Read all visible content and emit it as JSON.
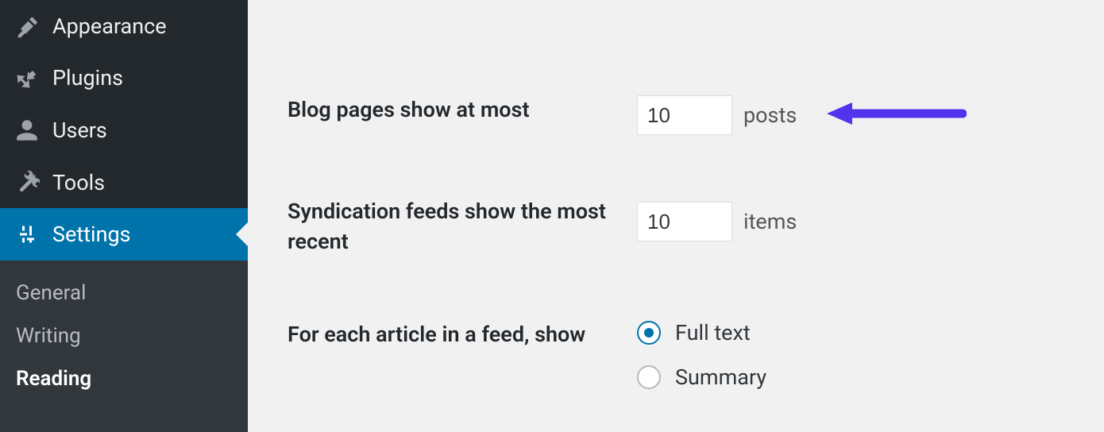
{
  "sidebar": {
    "items": [
      {
        "label": "Appearance"
      },
      {
        "label": "Plugins"
      },
      {
        "label": "Users"
      },
      {
        "label": "Tools"
      },
      {
        "label": "Settings"
      }
    ],
    "submenu": [
      {
        "label": "General"
      },
      {
        "label": "Writing"
      },
      {
        "label": "Reading"
      }
    ]
  },
  "settings": {
    "blog_pages": {
      "label": "Blog pages show at most",
      "value": "10",
      "unit": "posts"
    },
    "syndication": {
      "label": "Syndication feeds show the most recent",
      "value": "10",
      "unit": "items"
    },
    "feed_article": {
      "label": "For each article in a feed, show",
      "options": [
        {
          "label": "Full text",
          "selected": true
        },
        {
          "label": "Summary",
          "selected": false
        }
      ]
    }
  },
  "colors": {
    "sidebar_bg": "#23282d",
    "sidebar_active": "#0073aa",
    "submenu_bg": "#32373c",
    "text_dark": "#23282d",
    "text_muted": "#555",
    "accent_arrow": "#5333ed"
  }
}
